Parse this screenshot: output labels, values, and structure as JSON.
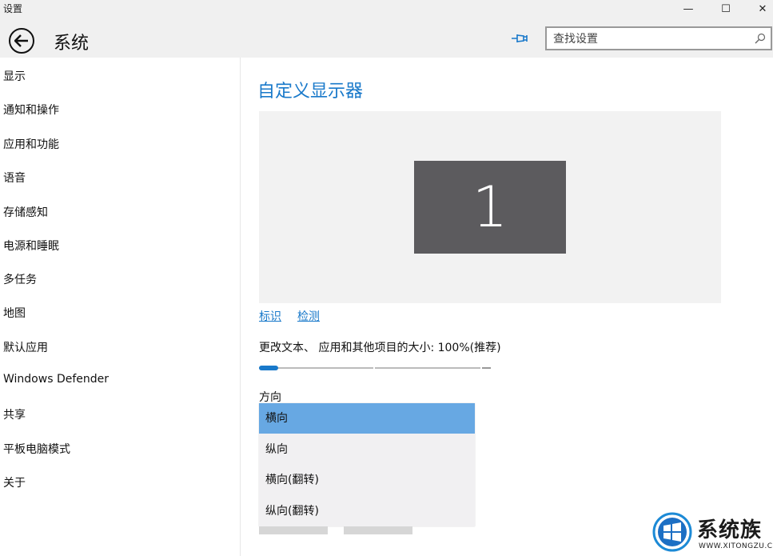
{
  "window": {
    "title": "设置",
    "minimize_glyph": "—",
    "maximize_glyph": "☐",
    "close_glyph": "✕"
  },
  "header": {
    "title": "系统",
    "search_placeholder": "查找设置"
  },
  "sidebar": {
    "items": [
      {
        "label": "显示"
      },
      {
        "label": "通知和操作"
      },
      {
        "label": "应用和功能"
      },
      {
        "label": "语音"
      },
      {
        "label": "存储感知"
      },
      {
        "label": "电源和睡眠"
      },
      {
        "label": "多任务"
      },
      {
        "label": "地图"
      },
      {
        "label": "默认应用"
      },
      {
        "label": "Windows Defender"
      },
      {
        "label": "共享"
      },
      {
        "label": "平板电脑模式"
      },
      {
        "label": "关于"
      }
    ]
  },
  "main": {
    "title": "自定义显示器",
    "monitor_number": "1",
    "identify_link": "标识",
    "detect_link": "检测",
    "scale_label": "更改文本、 应用和其他项目的大小: 100%(推荐)",
    "scale_slider_fraction": 0,
    "orientation_label": "方向",
    "orientation_options": [
      "横向",
      "纵向",
      "横向(翻转)",
      "纵向(翻转)"
    ],
    "orientation_selected": "横向"
  },
  "watermark": {
    "text": "系统族",
    "url": "WWW.XITONGZU.COM"
  },
  "colors": {
    "accent": "#1979ca",
    "selected_option": "#67a8e3",
    "monitor": "#5c5b5e",
    "titlebar": "#f0f0f0"
  }
}
